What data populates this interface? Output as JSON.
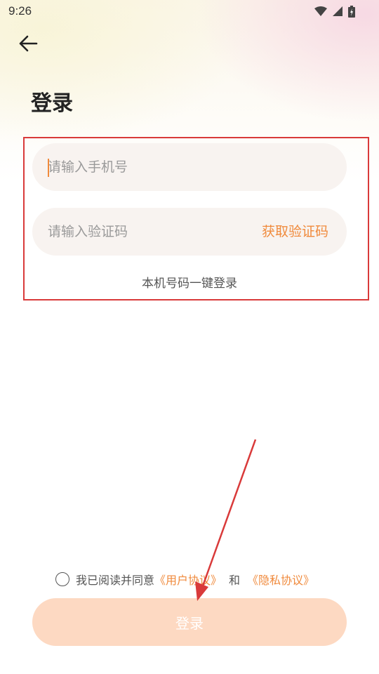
{
  "status_bar": {
    "time": "9:26",
    "icons": [
      "wifi-icon",
      "signal-icon",
      "battery-icon"
    ]
  },
  "header": {
    "back_icon": "arrow-left-icon",
    "title": "登录"
  },
  "form": {
    "phone_placeholder": "请输入手机号",
    "code_placeholder": "请输入验证码",
    "get_code_label": "获取验证码",
    "one_key_login_label": "本机号码一键登录"
  },
  "agreement": {
    "prefix": "我已阅读并同意",
    "user_agreement": "《用户协议》",
    "and": "和",
    "privacy_policy": "《隐私协议》",
    "checked": false
  },
  "login_button": {
    "label": "登录"
  },
  "colors": {
    "accent": "#f08a3c",
    "button_bg": "#fdd9c2",
    "field_bg": "#f8f3f0",
    "annotation_red": "#d93a3a"
  }
}
